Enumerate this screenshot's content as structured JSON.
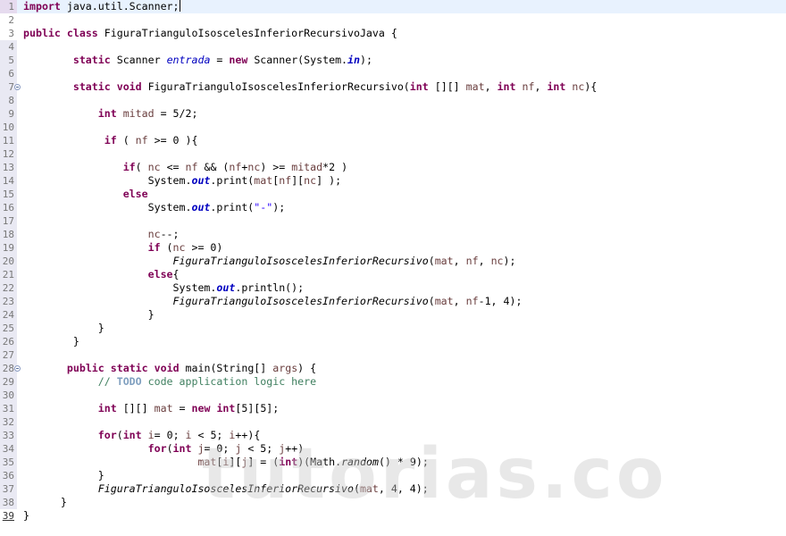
{
  "editor": {
    "language": "java",
    "current_line": 1,
    "colors": {
      "keyword": "#7f0055",
      "string": "#2a00ff",
      "comment": "#3f7f5f",
      "field": "#0000c0",
      "variable": "#6a3e3e",
      "current_line_bg": "#e8f2fe",
      "line_number": "#787878"
    },
    "lines": [
      {
        "n": "1",
        "tokens": [
          [
            "kw",
            "import"
          ],
          [
            "t",
            " java.util.Scanner;"
          ]
        ],
        "caret": true
      },
      {
        "n": "2",
        "tokens": []
      },
      {
        "n": "3",
        "tokens": [
          [
            "kw",
            "public"
          ],
          [
            "t",
            " "
          ],
          [
            "kw",
            "class"
          ],
          [
            "t",
            " FiguraTrianguloIsoscelesInferiorRecursivoJava {"
          ]
        ]
      },
      {
        "n": "4",
        "tokens": []
      },
      {
        "n": "5",
        "tokens": [
          [
            "t",
            "        "
          ],
          [
            "kw",
            "static"
          ],
          [
            "t",
            " Scanner "
          ],
          [
            "fld",
            "entrada"
          ],
          [
            "t",
            " = "
          ],
          [
            "kw",
            "new"
          ],
          [
            "t",
            " Scanner(System."
          ],
          [
            "sfld",
            "in"
          ],
          [
            "t",
            ");"
          ]
        ]
      },
      {
        "n": "6",
        "tokens": []
      },
      {
        "n": "7",
        "fold": true,
        "tokens": [
          [
            "t",
            "        "
          ],
          [
            "kw",
            "static"
          ],
          [
            "t",
            " "
          ],
          [
            "kw",
            "void"
          ],
          [
            "t",
            " FiguraTrianguloIsoscelesInferiorRecursivo("
          ],
          [
            "kw",
            "int"
          ],
          [
            "t",
            " [][] "
          ],
          [
            "var",
            "mat"
          ],
          [
            "t",
            ", "
          ],
          [
            "kw",
            "int"
          ],
          [
            "t",
            " "
          ],
          [
            "var",
            "nf"
          ],
          [
            "t",
            ", "
          ],
          [
            "kw",
            "int"
          ],
          [
            "t",
            " "
          ],
          [
            "var",
            "nc"
          ],
          [
            "t",
            "){"
          ]
        ]
      },
      {
        "n": "8",
        "tokens": []
      },
      {
        "n": "9",
        "tokens": [
          [
            "t",
            "            "
          ],
          [
            "kw",
            "int"
          ],
          [
            "t",
            " "
          ],
          [
            "var",
            "mitad"
          ],
          [
            "t",
            " = 5/2;"
          ]
        ]
      },
      {
        "n": "10",
        "tokens": []
      },
      {
        "n": "11",
        "tokens": [
          [
            "t",
            "             "
          ],
          [
            "kw",
            "if"
          ],
          [
            "t",
            " ( "
          ],
          [
            "var",
            "nf"
          ],
          [
            "t",
            " >= 0 ){"
          ]
        ]
      },
      {
        "n": "12",
        "tokens": []
      },
      {
        "n": "13",
        "tokens": [
          [
            "t",
            "                "
          ],
          [
            "kw",
            "if"
          ],
          [
            "t",
            "( "
          ],
          [
            "var",
            "nc"
          ],
          [
            "t",
            " <= "
          ],
          [
            "var",
            "nf"
          ],
          [
            "t",
            " && ("
          ],
          [
            "var",
            "nf"
          ],
          [
            "t",
            "+"
          ],
          [
            "var",
            "nc"
          ],
          [
            "t",
            ") >= "
          ],
          [
            "var",
            "mitad"
          ],
          [
            "t",
            "*2 )"
          ]
        ]
      },
      {
        "n": "14",
        "tokens": [
          [
            "t",
            "                    System."
          ],
          [
            "sfld",
            "out"
          ],
          [
            "t",
            ".print("
          ],
          [
            "var",
            "mat"
          ],
          [
            "t",
            "["
          ],
          [
            "var",
            "nf"
          ],
          [
            "t",
            "]["
          ],
          [
            "var",
            "nc"
          ],
          [
            "t",
            "] );"
          ]
        ]
      },
      {
        "n": "15",
        "tokens": [
          [
            "t",
            "                "
          ],
          [
            "kw",
            "else"
          ]
        ]
      },
      {
        "n": "16",
        "tokens": [
          [
            "t",
            "                    System."
          ],
          [
            "sfld",
            "out"
          ],
          [
            "t",
            ".print("
          ],
          [
            "str",
            "\"-\""
          ],
          [
            "t",
            ");"
          ]
        ]
      },
      {
        "n": "17",
        "tokens": []
      },
      {
        "n": "18",
        "tokens": [
          [
            "t",
            "                    "
          ],
          [
            "var",
            "nc"
          ],
          [
            "t",
            "--;"
          ]
        ]
      },
      {
        "n": "19",
        "tokens": [
          [
            "t",
            "                    "
          ],
          [
            "kw",
            "if"
          ],
          [
            "t",
            " ("
          ],
          [
            "var",
            "nc"
          ],
          [
            "t",
            " >= 0)"
          ]
        ]
      },
      {
        "n": "20",
        "tokens": [
          [
            "t",
            "                        "
          ],
          [
            "smeth",
            "FiguraTrianguloIsoscelesInferiorRecursivo"
          ],
          [
            "t",
            "("
          ],
          [
            "var",
            "mat"
          ],
          [
            "t",
            ", "
          ],
          [
            "var",
            "nf"
          ],
          [
            "t",
            ", "
          ],
          [
            "var",
            "nc"
          ],
          [
            "t",
            ");"
          ]
        ]
      },
      {
        "n": "21",
        "tokens": [
          [
            "t",
            "                    "
          ],
          [
            "kw",
            "else"
          ],
          [
            "t",
            "{"
          ]
        ]
      },
      {
        "n": "22",
        "tokens": [
          [
            "t",
            "                        System."
          ],
          [
            "sfld",
            "out"
          ],
          [
            "t",
            ".println();"
          ]
        ]
      },
      {
        "n": "23",
        "tokens": [
          [
            "t",
            "                        "
          ],
          [
            "smeth",
            "FiguraTrianguloIsoscelesInferiorRecursivo"
          ],
          [
            "t",
            "("
          ],
          [
            "var",
            "mat"
          ],
          [
            "t",
            ", "
          ],
          [
            "var",
            "nf"
          ],
          [
            "t",
            "-1, 4);"
          ]
        ]
      },
      {
        "n": "24",
        "tokens": [
          [
            "t",
            "                    }"
          ]
        ]
      },
      {
        "n": "25",
        "tokens": [
          [
            "t",
            "            }"
          ]
        ]
      },
      {
        "n": "26",
        "tokens": [
          [
            "t",
            "        }"
          ]
        ]
      },
      {
        "n": "27",
        "tokens": []
      },
      {
        "n": "28",
        "fold": true,
        "tokens": [
          [
            "t",
            "       "
          ],
          [
            "kw",
            "public"
          ],
          [
            "t",
            " "
          ],
          [
            "kw",
            "static"
          ],
          [
            "t",
            " "
          ],
          [
            "kw",
            "void"
          ],
          [
            "t",
            " main(String[] "
          ],
          [
            "var",
            "args"
          ],
          [
            "t",
            ") {"
          ]
        ]
      },
      {
        "n": "29",
        "tokens": [
          [
            "t",
            "            "
          ],
          [
            "cm",
            "// "
          ],
          [
            "todo",
            "TODO"
          ],
          [
            "cm",
            " code application logic here"
          ]
        ]
      },
      {
        "n": "30",
        "tokens": []
      },
      {
        "n": "31",
        "tokens": [
          [
            "t",
            "            "
          ],
          [
            "kw",
            "int"
          ],
          [
            "t",
            " [][] "
          ],
          [
            "var",
            "mat"
          ],
          [
            "t",
            " = "
          ],
          [
            "kw",
            "new"
          ],
          [
            "t",
            " "
          ],
          [
            "kw",
            "int"
          ],
          [
            "t",
            "[5][5];"
          ]
        ]
      },
      {
        "n": "32",
        "tokens": []
      },
      {
        "n": "33",
        "tokens": [
          [
            "t",
            "            "
          ],
          [
            "kw",
            "for"
          ],
          [
            "t",
            "("
          ],
          [
            "kw",
            "int"
          ],
          [
            "t",
            " "
          ],
          [
            "var",
            "i"
          ],
          [
            "t",
            "= 0; "
          ],
          [
            "var",
            "i"
          ],
          [
            "t",
            " < 5; "
          ],
          [
            "var",
            "i"
          ],
          [
            "t",
            "++){"
          ]
        ]
      },
      {
        "n": "34",
        "tokens": [
          [
            "t",
            "                    "
          ],
          [
            "kw",
            "for"
          ],
          [
            "t",
            "("
          ],
          [
            "kw",
            "int"
          ],
          [
            "t",
            " "
          ],
          [
            "var",
            "j"
          ],
          [
            "t",
            "= 0; "
          ],
          [
            "var",
            "j"
          ],
          [
            "t",
            " < 5; "
          ],
          [
            "var",
            "j"
          ],
          [
            "t",
            "++)"
          ]
        ]
      },
      {
        "n": "35",
        "tokens": [
          [
            "t",
            "                            "
          ],
          [
            "var",
            "mat"
          ],
          [
            "t",
            "["
          ],
          [
            "var",
            "i"
          ],
          [
            "t",
            "]["
          ],
          [
            "var",
            "j"
          ],
          [
            "t",
            "] = ("
          ],
          [
            "kw",
            "int"
          ],
          [
            "t",
            ")(Math."
          ],
          [
            "smeth",
            "random"
          ],
          [
            "t",
            "() * 9);"
          ]
        ]
      },
      {
        "n": "36",
        "tokens": [
          [
            "t",
            "            }"
          ]
        ]
      },
      {
        "n": "37",
        "tokens": [
          [
            "t",
            "            "
          ],
          [
            "smeth",
            "FiguraTrianguloIsoscelesInferiorRecursivo"
          ],
          [
            "t",
            "("
          ],
          [
            "var",
            "mat"
          ],
          [
            "t",
            ", 4, 4);"
          ]
        ]
      },
      {
        "n": "38",
        "tokens": [
          [
            "t",
            "      }"
          ]
        ]
      },
      {
        "n": "39",
        "underline": true,
        "tokens": [
          [
            "t",
            "}"
          ]
        ]
      }
    ]
  },
  "watermark": {
    "text": "tutorias.co"
  }
}
